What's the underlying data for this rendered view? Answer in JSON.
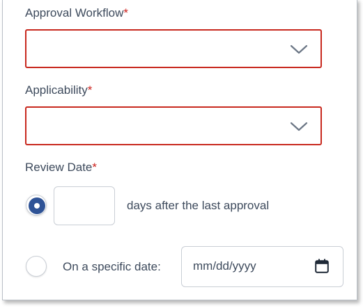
{
  "approval_workflow": {
    "label": "Approval Workflow",
    "required_mark": "*",
    "value": ""
  },
  "applicability": {
    "label": "Applicability",
    "required_mark": "*",
    "value": ""
  },
  "review_date": {
    "label": "Review Date",
    "required_mark": "*",
    "option_days": {
      "selected": true,
      "days_value": "",
      "suffix": "days after the last approval"
    },
    "option_specific": {
      "selected": false,
      "label": "On a specific date:",
      "date_placeholder": "mm/dd/yyyy"
    }
  },
  "icons": {
    "dropdown": "chevron-down-icon",
    "calendar": "calendar-icon"
  },
  "colors": {
    "required": "#cc1f1a",
    "error_border": "#c8281e",
    "radio_selected": "#2f5396",
    "text": "#3d4a5c"
  }
}
